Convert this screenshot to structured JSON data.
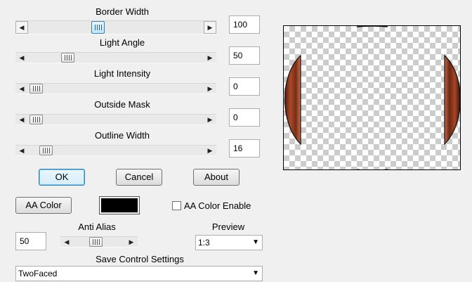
{
  "sliders": [
    {
      "label": "Border Width",
      "value": "100",
      "level": 0.44
    },
    {
      "label": "Light Angle",
      "value": "50",
      "level": 0.24
    },
    {
      "label": "Light Intensity",
      "value": "0",
      "level": 0.0
    },
    {
      "label": "Outside Mask",
      "value": "0",
      "level": 0.0
    },
    {
      "label": "Outline Width",
      "value": "16",
      "level": 0.12
    }
  ],
  "buttons": {
    "ok": "OK",
    "cancel": "Cancel",
    "about": "About",
    "aa_color": "AA Color"
  },
  "aa_color": {
    "color": "#000000",
    "enable_label": "AA Color Enable",
    "enabled": false
  },
  "anti_alias": {
    "label": "Anti Alias",
    "value": "50",
    "level": 0.46
  },
  "preview": {
    "label": "Preview",
    "selected": "1:3"
  },
  "save_settings": {
    "label": "Save Control Settings",
    "selected": "TwoFaced"
  },
  "colors": {
    "accent": "#3c7fb1",
    "ring": "#8b3a1c"
  }
}
